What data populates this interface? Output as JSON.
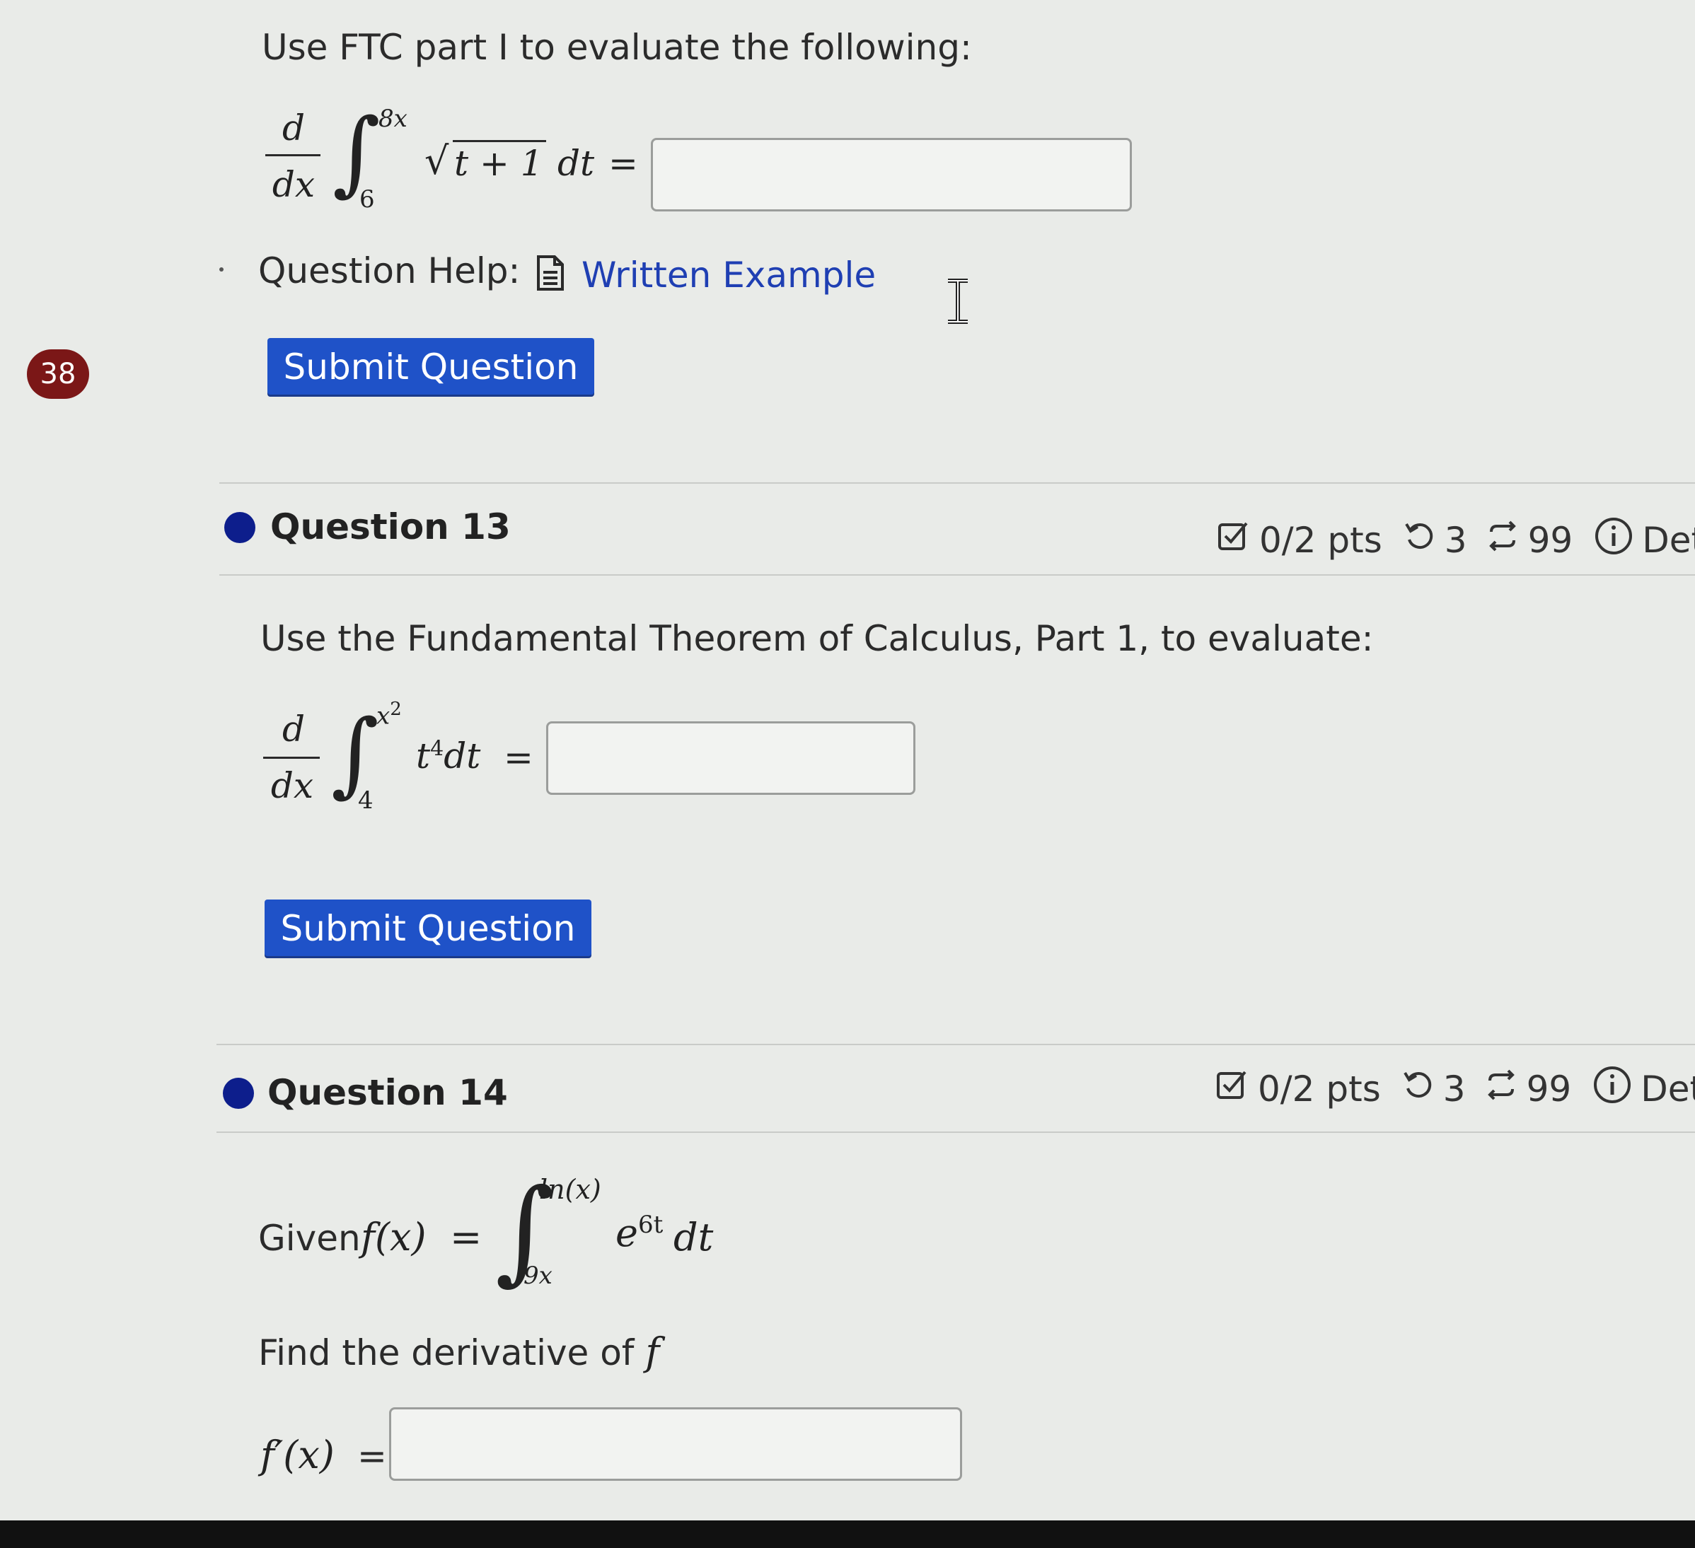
{
  "badge": "38",
  "q12": {
    "prompt": "Use FTC part I to evaluate the following:",
    "math": {
      "d": "d",
      "dx": "dx",
      "upper": "8x",
      "lower": "6",
      "integrand": "t + 1",
      "dt": "dt",
      "eq": "="
    },
    "help_label": "Question Help:",
    "help_link": "Written Example",
    "submit": "Submit Question"
  },
  "q13": {
    "title": "Question 13",
    "pts": "0/2 pts",
    "tries": "3",
    "attempts": "99",
    "details": "Deta",
    "prompt": "Use the Fundamental Theorem of Calculus, Part 1, to evaluate:",
    "math": {
      "d": "d",
      "dx": "dx",
      "upper_base": "x",
      "upper_exp": "2",
      "lower": "4",
      "integrand_base": "t",
      "integrand_exp": "4",
      "dt": "dt",
      "eq": "="
    },
    "submit": "Submit Question"
  },
  "q14": {
    "title": "Question 14",
    "pts": "0/2 pts",
    "tries": "3",
    "attempts": "99",
    "details": "Deta",
    "given_label": "Given",
    "fx": "f(x)",
    "eq": "=",
    "upper": "ln(x)",
    "lower": "9x",
    "integrand_base": "e",
    "integrand_exp": "6t",
    "dt": "dt",
    "find_text": "Find the derivative of",
    "find_var": "f",
    "answer_label": "f′(x)",
    "answer_eq": "="
  },
  "colors": {
    "accent": "#1f52c8",
    "badge": "#7b1717",
    "dot": "#0d1e8c",
    "link": "#1f3fb3"
  },
  "icons": [
    "document-icon",
    "checkbox-icon",
    "retry-icon",
    "attempts-icon",
    "info-icon",
    "text-cursor-icon"
  ]
}
